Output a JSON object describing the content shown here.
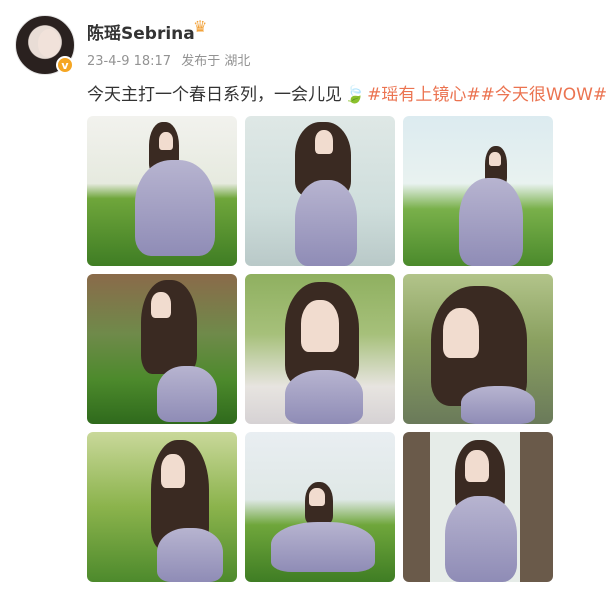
{
  "post": {
    "username": "陈瑶Sebrina",
    "date": "23-4-9 18:17",
    "source": "发布于 湖北",
    "text": "今天主打一个春日系列，一会儿见",
    "hashtag1": "#瑶有上镜心#",
    "hashtag2": "#今天很WOW#"
  },
  "icons": {
    "verified": "verified-badge-icon",
    "crown": "member-crown-icon",
    "leaf": "leaf-emoji-icon"
  },
  "colors": {
    "hashtag": "#eb7350",
    "meta": "#939393",
    "verified": "#f5a623"
  },
  "photos": [
    {
      "name": "photo-1"
    },
    {
      "name": "photo-2"
    },
    {
      "name": "photo-3"
    },
    {
      "name": "photo-4"
    },
    {
      "name": "photo-5"
    },
    {
      "name": "photo-6"
    },
    {
      "name": "photo-7"
    },
    {
      "name": "photo-8"
    },
    {
      "name": "photo-9"
    }
  ]
}
